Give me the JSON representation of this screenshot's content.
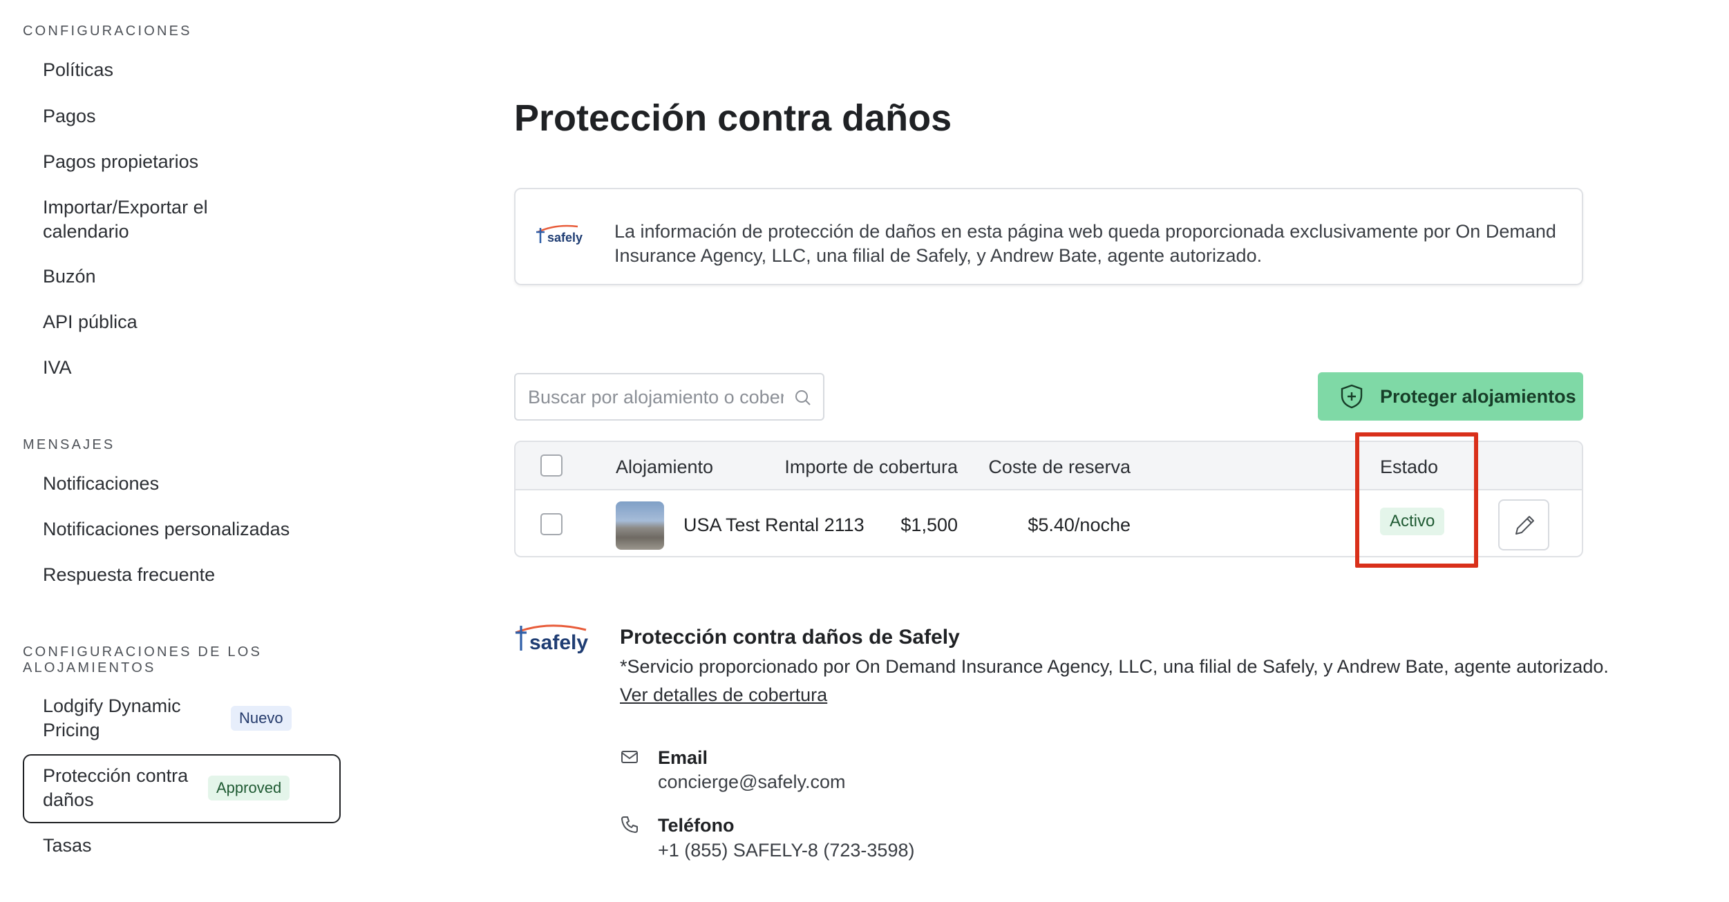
{
  "sidebar": {
    "section_configuraciones": "CONFIGURACIONES",
    "items_config": [
      {
        "label": "Políticas"
      },
      {
        "label": "Pagos"
      },
      {
        "label": "Pagos propietarios"
      },
      {
        "label": "Importar/Exportar el calendario"
      },
      {
        "label": "Buzón"
      },
      {
        "label": "API pública"
      },
      {
        "label": "IVA"
      }
    ],
    "section_mensajes": "MENSAJES",
    "items_mensajes": [
      {
        "label": "Notificaciones"
      },
      {
        "label": "Notificaciones personalizadas"
      },
      {
        "label": "Respuesta frecuente"
      }
    ],
    "section_alojamientos": "CONFIGURACIONES DE LOS ALOJAMIENTOS",
    "items_alojamientos": [
      {
        "label": "Lodgify Dynamic Pricing",
        "badge": "Nuevo"
      },
      {
        "label": "Protección contra daños",
        "badge": "Approved",
        "active": true
      },
      {
        "label": "Tasas"
      }
    ]
  },
  "main": {
    "title": "Protección contra daños",
    "info_logo_text": "safely",
    "info_text": "La información de protección de daños en esta página web queda proporcionada exclusivamente por On Demand Insurance Agency, LLC, una filial de Safely, y Andrew Bate, agente autorizado.",
    "search": {
      "placeholder": "Buscar por alojamiento o cobertura",
      "value": ""
    },
    "protect_button": "Proteger alojamientos",
    "table": {
      "headers": {
        "property": "Alojamiento",
        "coverage": "Importe de cobertura",
        "cost": "Coste de reserva",
        "status": "Estado"
      },
      "rows": [
        {
          "property": "USA Test Rental 2113",
          "coverage": "$1,500",
          "cost": "$5.40/noche",
          "status": "Activo"
        }
      ]
    },
    "safely": {
      "logo_text": "safely",
      "title": "Protección contra daños de Safely",
      "subtitle": "*Servicio proporcionado por On Demand Insurance Agency, LLC, una filial de Safely, y Andrew Bate, agente autorizado.",
      "link": "Ver detalles de cobertura",
      "email_label": "Email",
      "email_value": "concierge@safely.com",
      "phone_label": "Teléfono",
      "phone_value": "+1 (855) SAFELY-8 (723-3598)"
    }
  },
  "colors": {
    "accent_green": "#7fd9a6",
    "highlight_red": "#d9301a",
    "status_bg": "#e4f5ea"
  }
}
